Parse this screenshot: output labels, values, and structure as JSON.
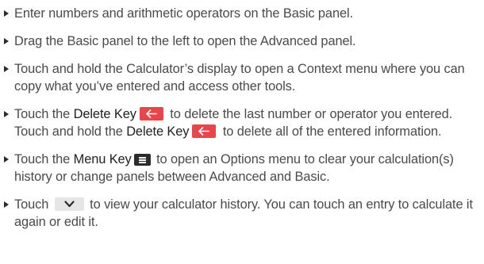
{
  "items": [
    {
      "text": "Enter numbers and arithmetic operators on the Basic panel."
    },
    {
      "text": "Drag the Basic panel to the left to open the Advanced panel."
    },
    {
      "text": "Touch and hold the Calculator’s display to open a Context menu where you can copy what you’ve entered and access other tools."
    },
    {
      "pre": "Touch the ",
      "term1": "Delete Key",
      "mid": " to delete the last number or operator you entered. Touch and hold the ",
      "term2": "Delete Key",
      "post": " to delete all of the entered information."
    },
    {
      "pre": "Touch the ",
      "term": "Menu Key",
      "post": " to open an Options menu to clear your calculation(s) history or change panels between Advanced and Basic."
    },
    {
      "pre": "Touch ",
      "post": " to view your calculator history. You can touch an entry to calculate it again or edit it."
    }
  ],
  "icons": {
    "delete_key": "back-arrow-icon",
    "menu_key": "menu-icon",
    "history": "chevron-down-icon"
  },
  "colors": {
    "delete_key_bg": "#e8464a",
    "menu_key_bg": "#2b2b2b",
    "history_bg": "#e6e6e6"
  }
}
